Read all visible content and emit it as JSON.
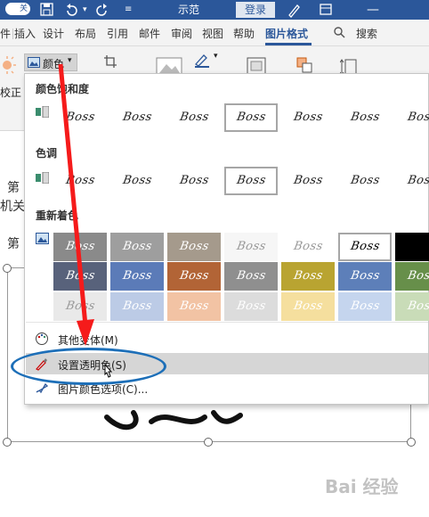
{
  "titlebar": {
    "toggle_label": "关",
    "doc_title": "示范",
    "login_label": "登录",
    "save_icon": "save-icon",
    "bg": "#2b579a"
  },
  "tabs": [
    {
      "label": "件"
    },
    {
      "label": "插入"
    },
    {
      "label": "设计"
    },
    {
      "label": "布局"
    },
    {
      "label": "引用"
    },
    {
      "label": "邮件"
    },
    {
      "label": "审阅"
    },
    {
      "label": "视图"
    },
    {
      "label": "帮助"
    },
    {
      "label": "图片格式",
      "active": true
    }
  ],
  "search_label": "搜索",
  "ribbon": {
    "color_label": "颜色",
    "correct_label": "校正"
  },
  "document": {
    "line1": "第",
    "line2": "机关",
    "line3": "第"
  },
  "panel": {
    "saturation_heading": "颜色饱和度",
    "tone_heading": "色调",
    "recolor_heading": "重新着色",
    "thumb_text": "Boss",
    "saturation_selected": 3,
    "tone_selected": 3,
    "recolor_row1_colors": [
      "#8a8a8a",
      "#9e9e9e",
      "#a59a8c",
      "#f6f6f6",
      "#ffffff",
      "#ffffff",
      "#000000"
    ],
    "recolor_row2_colors": [
      "#58627b",
      "#5b7bb8",
      "#b26436",
      "#8f8f8f",
      "#b9a431",
      "#5d7fb9",
      "#678f4a"
    ],
    "recolor_row3_colors": [
      "#e9e9e9",
      "#bccbe6",
      "#f2c3a4",
      "#dcdcdc",
      "#f5df9e",
      "#c5d5ee",
      "#c9dcb8"
    ],
    "menu_more": "其他变体(M)",
    "menu_set_transparent": "设置透明色(S)",
    "menu_picture_color_options": "图片颜色选项(C)..."
  },
  "watermark": "Bai 经验",
  "colors": {
    "accent": "#2b579a",
    "arrow": "#f51b1b",
    "ellipse": "#1d6fb8"
  }
}
